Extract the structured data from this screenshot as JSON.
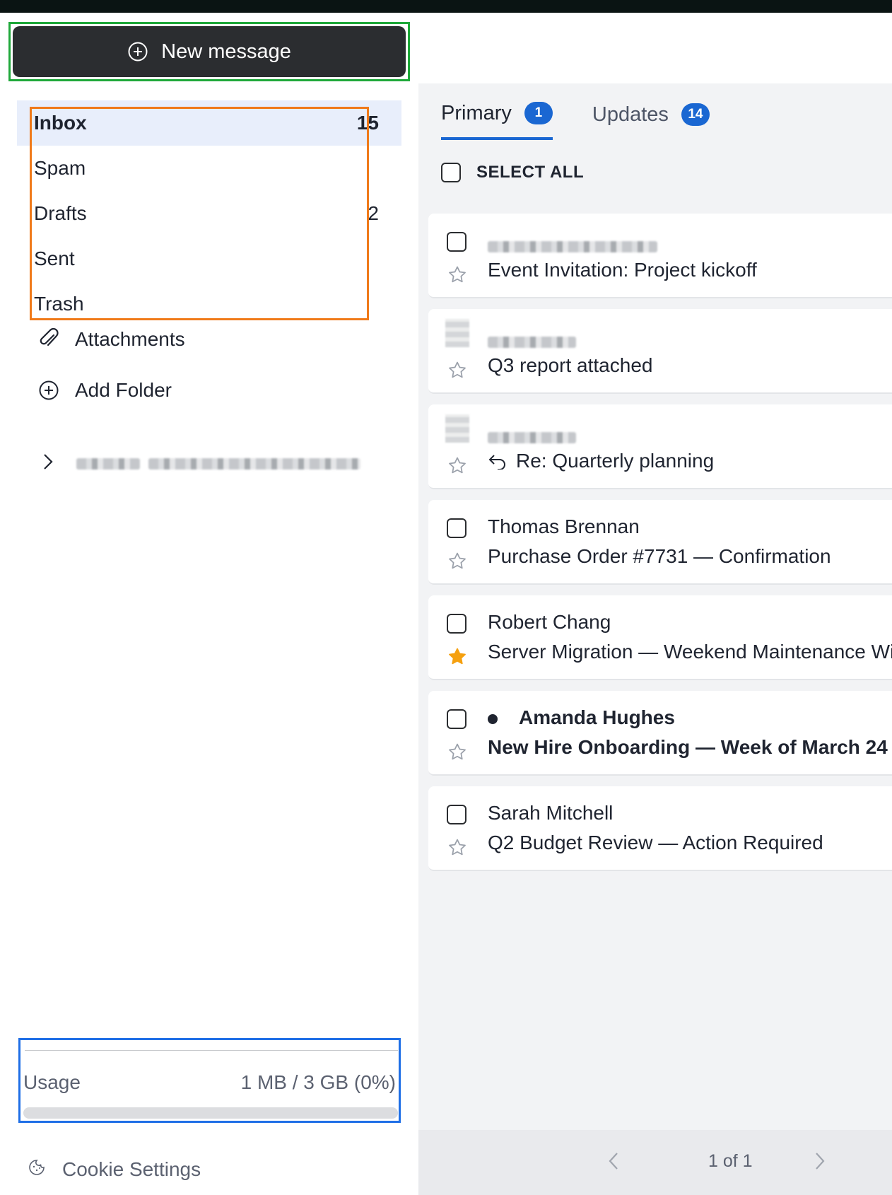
{
  "compose": {
    "label": "New message",
    "icon": "plus-circle-icon"
  },
  "folders": [
    {
      "label": "Inbox",
      "count": "15"
    },
    {
      "label": "Spam",
      "count": ""
    },
    {
      "label": "Drafts",
      "count": "2"
    },
    {
      "label": "Sent",
      "count": ""
    },
    {
      "label": "Trash",
      "count": ""
    }
  ],
  "links": {
    "attachments": "Attachments",
    "add_folder": "Add Folder"
  },
  "usage": {
    "label": "Usage",
    "value": "1 MB / 3 GB (0%)",
    "fraction": 0.0
  },
  "cookie": {
    "label": "Cookie Settings"
  },
  "tabs": [
    {
      "label": "Primary",
      "badge": "1"
    },
    {
      "label": "Updates",
      "badge": "14"
    }
  ],
  "select_all": "SELECT ALL",
  "messages": [
    {
      "sender": "",
      "subject": "Event Invitation: Project kickoff",
      "starred": false,
      "unread": false,
      "reply": false
    },
    {
      "sender": "",
      "subject": "Q3 report attached",
      "starred": false,
      "unread": false,
      "reply": false
    },
    {
      "sender": "",
      "subject": "Re: Quarterly planning",
      "starred": false,
      "unread": false,
      "reply": true
    },
    {
      "sender": "Thomas Brennan",
      "subject": "Purchase Order #7731 — Confirmation",
      "starred": false,
      "unread": false,
      "reply": false
    },
    {
      "sender": "Robert Chang",
      "subject": "Server Migration — Weekend Maintenance Wir",
      "starred": true,
      "unread": false,
      "reply": false
    },
    {
      "sender": "Amanda Hughes",
      "subject": "New Hire Onboarding — Week of March 24",
      "starred": false,
      "unread": true,
      "reply": false
    },
    {
      "sender": "Sarah Mitchell",
      "subject": "Q2 Budget Review — Action Required",
      "starred": false,
      "unread": false,
      "reply": false
    }
  ],
  "pager": {
    "label": "1 of 1"
  },
  "colors": {
    "accent": "#1a67d2",
    "star": "#f5a00f",
    "compose_bg": "#2b2d30"
  }
}
